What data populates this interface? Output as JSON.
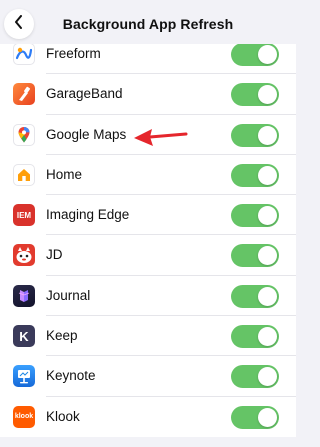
{
  "nav": {
    "title": "Background App Refresh",
    "back_icon": "chevron-left-icon"
  },
  "apps": [
    {
      "name": "Freeform",
      "icon": "freeform-icon",
      "color": "#2d7cf6",
      "enabled": true
    },
    {
      "name": "GarageBand",
      "icon": "garageband-icon",
      "color": "#f0622c",
      "enabled": true
    },
    {
      "name": "Google Maps",
      "icon": "google-maps-icon",
      "color": "#ffffff",
      "enabled": true
    },
    {
      "name": "Home",
      "icon": "home-icon",
      "color": "#ff9f0a",
      "enabled": true
    },
    {
      "name": "Imaging Edge",
      "icon": "imaging-edge-icon",
      "color": "#d9322b",
      "enabled": true
    },
    {
      "name": "JD",
      "icon": "jd-icon",
      "color": "#e23b2e",
      "enabled": true
    },
    {
      "name": "Journal",
      "icon": "journal-icon",
      "color": "#1c1c3c",
      "enabled": true
    },
    {
      "name": "Keep",
      "icon": "keep-icon",
      "color": "#3a3a5a",
      "enabled": true
    },
    {
      "name": "Keynote",
      "icon": "keynote-icon",
      "color": "#1e88e5",
      "enabled": true
    },
    {
      "name": "Klook",
      "icon": "klook-icon",
      "color": "#ff5b00",
      "enabled": true
    }
  ],
  "icon_labels": {
    "imaging_edge": "IEM",
    "keep": "K",
    "klook": "klook"
  },
  "colors": {
    "toggle_on": "#65c466",
    "annotation_arrow": "#e5262c"
  }
}
